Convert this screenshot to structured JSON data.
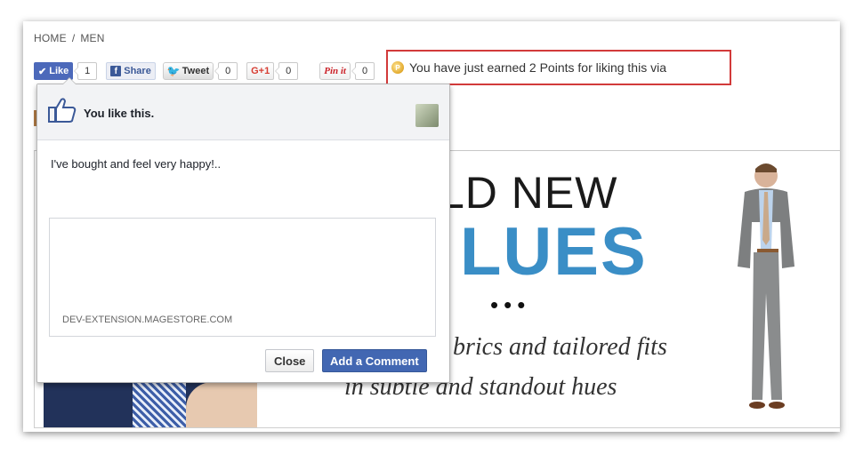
{
  "breadcrumb": {
    "home": "HOME",
    "separator": "/",
    "current": "MEN"
  },
  "social": {
    "like_label": "Like",
    "like_count": "1",
    "share_label": "Share",
    "tweet_label": "Tweet",
    "tweet_count": "0",
    "gplus_label": "G+1",
    "gplus_count": "0",
    "pin_label": "Pin it",
    "pin_count": "0"
  },
  "points_message": "You have just earned 2 Points for liking this via",
  "banner": {
    "headline_1": "LD NEW",
    "headline_2": "LUES",
    "dots": "•••",
    "tagline_1": "brics and tailored fits",
    "tagline_2": "in subtle and standout hues"
  },
  "fb_popup": {
    "you_like": "You like this.",
    "message": "I've bought and feel very happy!..",
    "domain": "DEV-EXTENSION.MAGESTORE.COM",
    "close_label": "Close",
    "add_comment_label": "Add a Comment"
  },
  "icons": {
    "like": "thumbs-up-icon",
    "facebook": "facebook-icon",
    "twitter": "twitter-bird-icon",
    "coin": "coin-icon"
  },
  "colors": {
    "facebook_blue": "#4c69ba",
    "highlight_border": "#d23a3a",
    "headline_blue": "#3a8ec6"
  }
}
